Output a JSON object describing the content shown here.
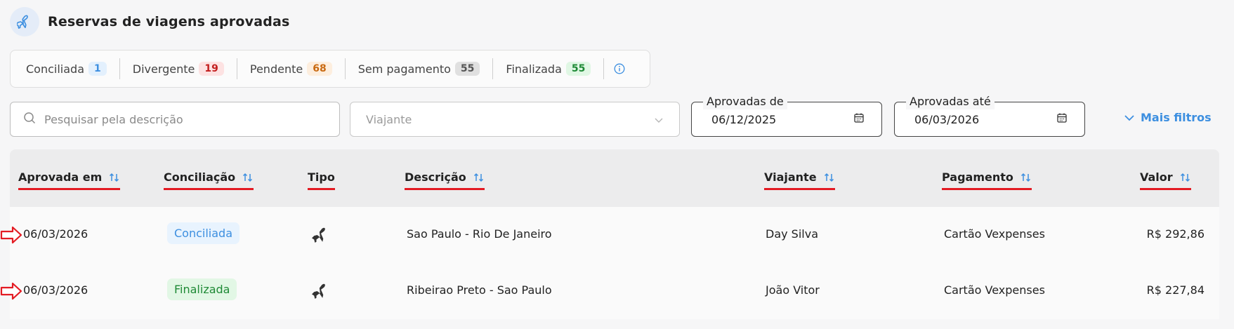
{
  "header": {
    "title": "Reservas de viagens aprovadas",
    "icon": "airplane-icon"
  },
  "status_tabs": [
    {
      "label": "Conciliada",
      "count": "1",
      "badge_bg": "#e3f0fd",
      "badge_fg": "#3d8fe0"
    },
    {
      "label": "Divergente",
      "count": "19",
      "badge_bg": "#fde2e2",
      "badge_fg": "#c21d1d"
    },
    {
      "label": "Pendente",
      "count": "68",
      "badge_bg": "#fdeede",
      "badge_fg": "#c96a12"
    },
    {
      "label": "Sem pagamento",
      "count": "55",
      "badge_bg": "#e0e0e0",
      "badge_fg": "#555555"
    },
    {
      "label": "Finalizada",
      "count": "55",
      "badge_bg": "#e0f7e4",
      "badge_fg": "#1f8a36"
    }
  ],
  "filters": {
    "search_placeholder": "Pesquisar pela descrição",
    "traveler_placeholder": "Viajante",
    "approved_from_label": "Aprovadas de",
    "approved_from_value": "06/12/2025",
    "approved_to_label": "Aprovadas até",
    "approved_to_value": "06/03/2026",
    "more_filters_label": "Mais filtros"
  },
  "table": {
    "columns": [
      "Aprovada em",
      "Conciliação",
      "Tipo",
      "Descrição",
      "Viajante",
      "Pagamento",
      "Valor"
    ],
    "rows": [
      {
        "date": "06/03/2026",
        "status": "Conciliada",
        "status_bg": "#e8f3fe",
        "status_fg": "#3d8fe0",
        "type_icon": "airplane-icon",
        "description": "Sao Paulo - Rio De Janeiro",
        "traveler": "Day Silva",
        "payment": "Cartão Vexpenses",
        "value": "R$ 292,86"
      },
      {
        "date": "06/03/2026",
        "status": "Finalizada",
        "status_bg": "#e2f7e5",
        "status_fg": "#1f8a36",
        "type_icon": "airplane-icon",
        "description": "Ribeirao Preto - Sao Paulo",
        "traveler": "João Vitor",
        "payment": "Cartão Vexpenses",
        "value": "R$ 227,84"
      }
    ]
  },
  "colors": {
    "accent": "#3d8fe0",
    "underline": "#e31b23"
  }
}
